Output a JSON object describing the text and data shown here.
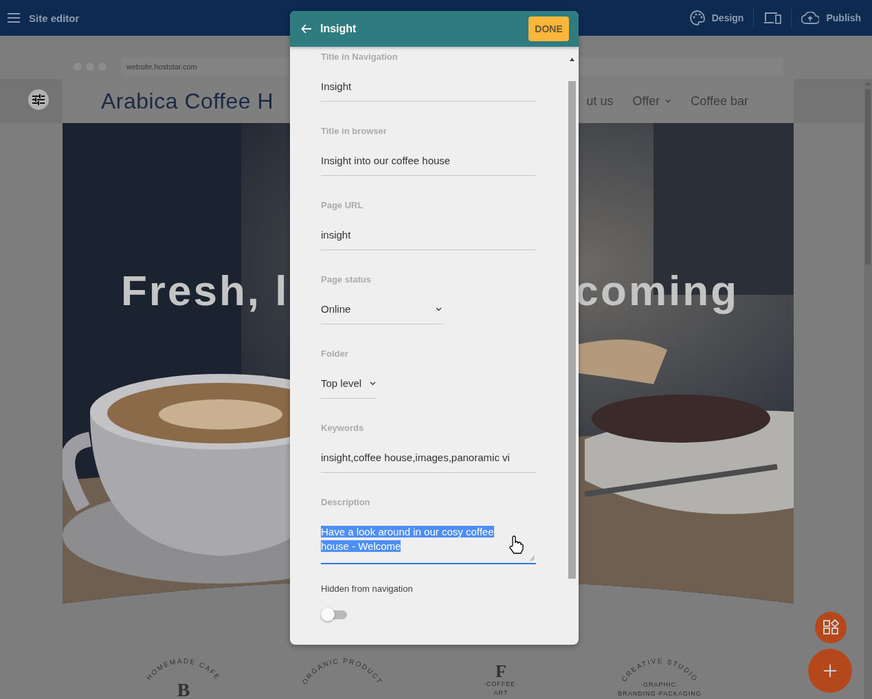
{
  "topbar": {
    "title": "Site editor",
    "design": "Design",
    "publish": "Publish"
  },
  "browser": {
    "url": "website.hoststar.com"
  },
  "site": {
    "logo_text": "Arabica Coffee H",
    "nav": [
      {
        "label": "ut us",
        "dropdown": false
      },
      {
        "label": "Offer",
        "dropdown": true
      },
      {
        "label": "Coffee bar",
        "dropdown": false
      }
    ],
    "hero": {
      "headline_left": "Fresh, l",
      "headline_right": "coming"
    },
    "logos": [
      {
        "arc": "HOMEMADE CAFE",
        "letter": "B"
      },
      {
        "arc": "ORGANIC PRODUCT"
      },
      {
        "letter": "F",
        "sub": "·COFFEE·",
        "sub2": "ART"
      },
      {
        "arc": "CREATIVE STUDIO",
        "sub": "·GRAPHIC·",
        "sub2": "·BRANDING·PACKAGING·"
      }
    ]
  },
  "dialog": {
    "title": "Insight",
    "done": "DONE",
    "fields": [
      {
        "kind": "text",
        "label": "Title in Navigation",
        "value": "Insight"
      },
      {
        "kind": "text",
        "label": "Title in browser",
        "value": "Insight into our coffee house"
      },
      {
        "kind": "text",
        "label": "Page URL",
        "value": "insight"
      },
      {
        "kind": "select",
        "label": "Page status",
        "value": "Online"
      },
      {
        "kind": "select",
        "label": "Folder",
        "value": "Top level"
      },
      {
        "kind": "text",
        "label": "Keywords",
        "value": "insight,coffee house,images,panoramic vi"
      },
      {
        "kind": "textarea",
        "label": "Description",
        "value": "Have a look around in our cosy coffee house - Welcome",
        "selected": true
      }
    ],
    "toggle": {
      "label": "Hidden from navigation",
      "on": false
    }
  }
}
